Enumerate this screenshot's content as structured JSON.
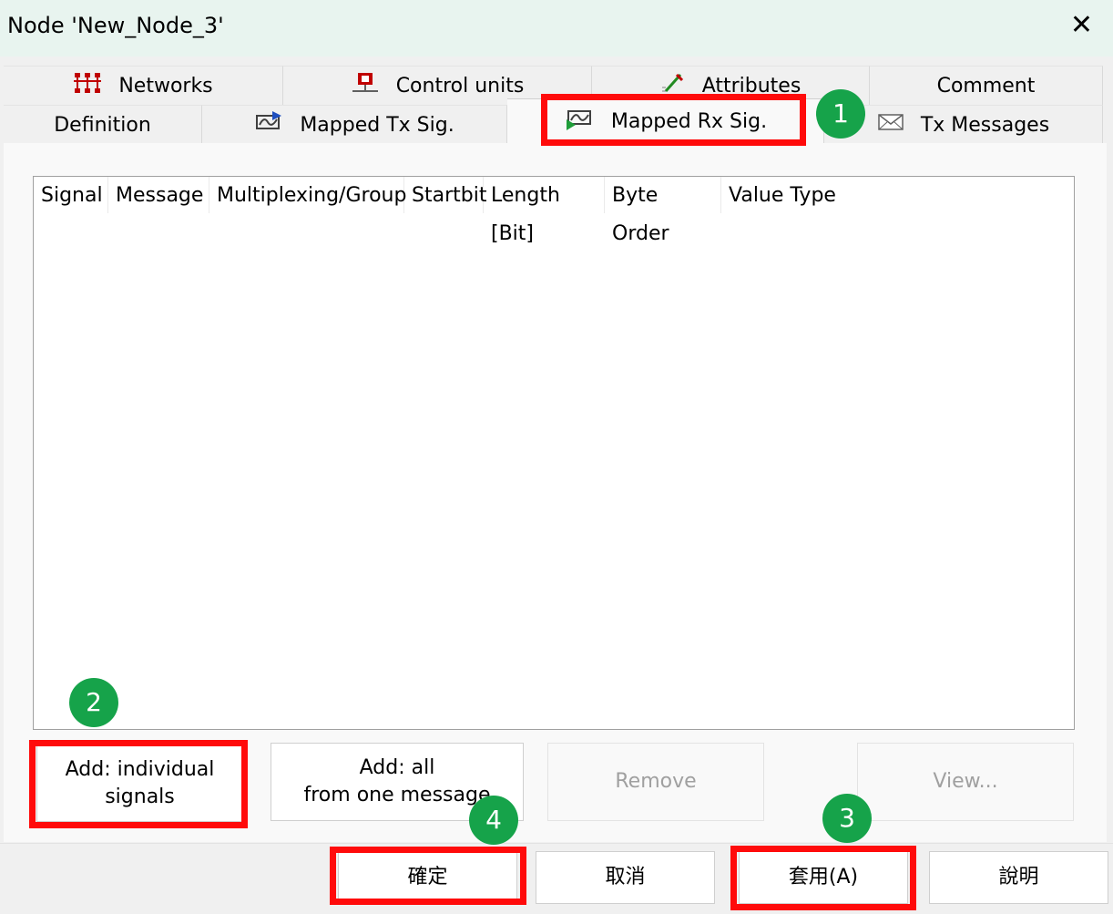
{
  "window": {
    "title": "Node 'New_Node_3'",
    "close_glyph": "✕"
  },
  "tabs": {
    "row1": [
      {
        "label": "Networks",
        "icon": "network-icon"
      },
      {
        "label": "Control units",
        "icon": "control-unit-icon"
      },
      {
        "label": "Attributes",
        "icon": "attributes-icon"
      },
      {
        "label": "Comment",
        "icon": ""
      }
    ],
    "row2": [
      {
        "label": "Definition",
        "icon": ""
      },
      {
        "label": "Mapped Tx Sig.",
        "icon": "mapped-tx-signal-icon"
      },
      {
        "label": "Mapped Rx Sig.",
        "icon": "mapped-rx-signal-icon",
        "active": true
      },
      {
        "label": "Tx Messages",
        "icon": "envelope-icon"
      }
    ]
  },
  "signal_list": {
    "columns": [
      "Signal",
      "Message",
      "Multiplexing/Group",
      "Startbit",
      "Length [Bit]",
      "Byte Order",
      "Value Type"
    ],
    "rows": []
  },
  "buttons": {
    "add_individual": [
      "Add: individual",
      "signals"
    ],
    "add_all": [
      "Add: all",
      "from one message"
    ],
    "remove": "Remove",
    "view": "View..."
  },
  "footer": {
    "ok": "確定",
    "cancel": "取消",
    "apply": "套用(A)",
    "help": "說明"
  },
  "annotations": {
    "step1": "1",
    "step2": "2",
    "step3": "3",
    "step4": "4",
    "box_color": "#ff0b0b",
    "badge_color": "#16a34a"
  }
}
